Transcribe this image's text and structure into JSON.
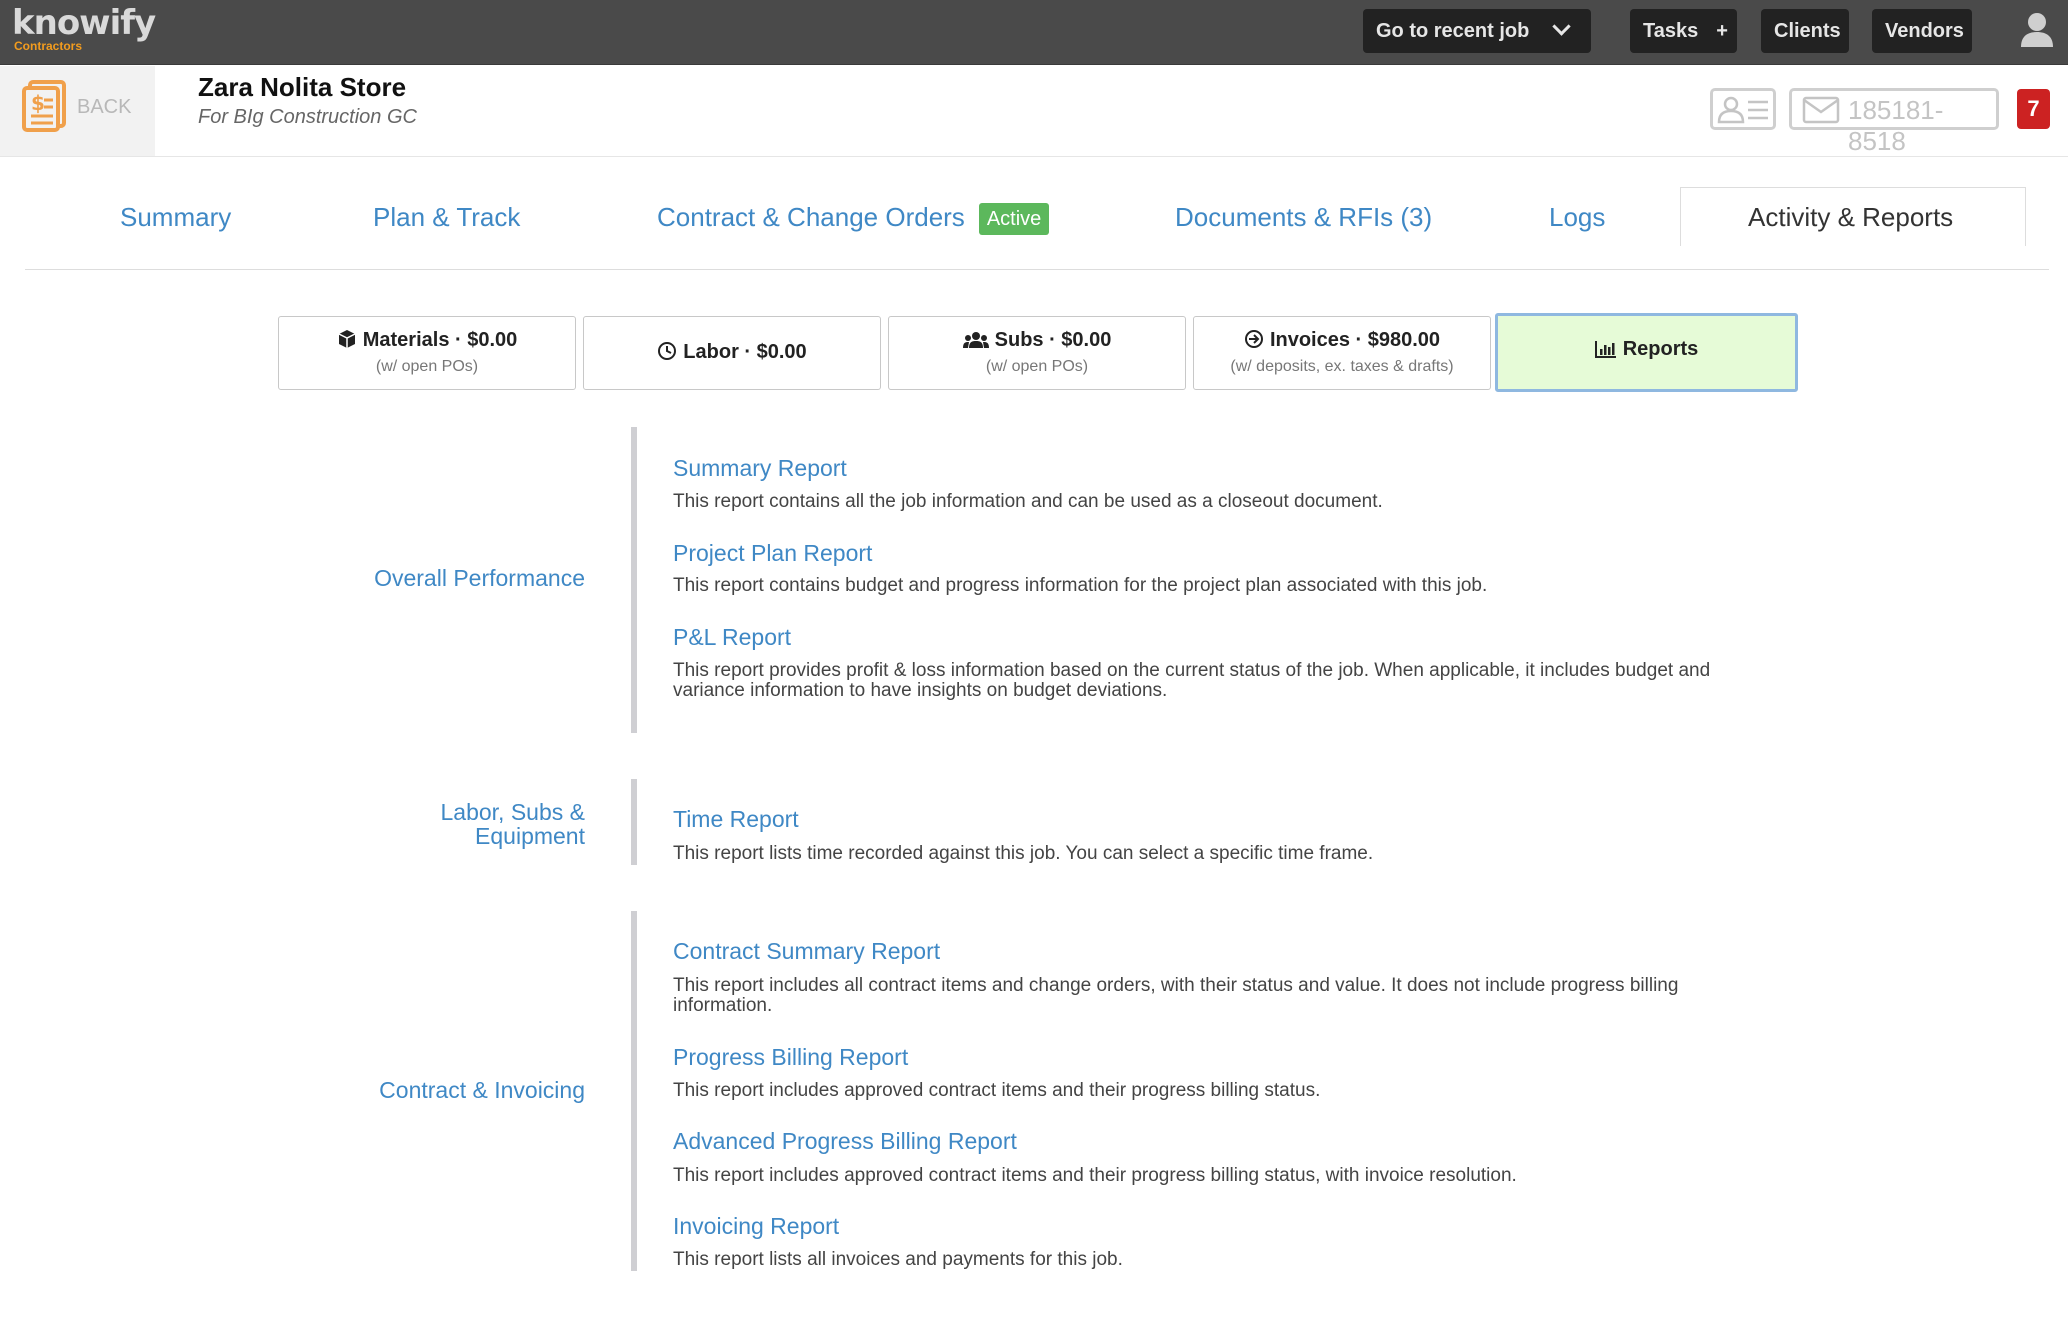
{
  "app": {
    "logo_text": "knowify",
    "logo_sub": "Contractors"
  },
  "topnav": {
    "recent_job": "Go to recent job",
    "tasks": "Tasks",
    "tasks_plus": "+",
    "clients": "Clients",
    "vendors": "Vendors"
  },
  "job": {
    "back_label": "BACK",
    "title": "Zara Nolita Store",
    "subtitle": "For BIg Construction GC",
    "phone": "185181-8518",
    "notification_count": "7"
  },
  "tabs": {
    "summary": "Summary",
    "plan_track": "Plan & Track",
    "contract": "Contract & Change Orders",
    "contract_badge": "Active",
    "documents": "Documents & RFIs (3)",
    "logs": "Logs",
    "activity": "Activity & Reports"
  },
  "summary_boxes": {
    "materials": {
      "title": "Materials · $0.00",
      "sub": "(w/ open POs)"
    },
    "labor": {
      "title": "Labor · $0.00"
    },
    "subs": {
      "title": "Subs · $0.00",
      "sub": "(w/ open POs)"
    },
    "invoices": {
      "title": "Invoices · $980.00",
      "sub": "(w/ deposits, ex. taxes & drafts)"
    },
    "reports": {
      "title": "Reports"
    }
  },
  "sections": {
    "overall": {
      "label": "Overall Performance",
      "reports": [
        {
          "title": "Summary Report",
          "desc": "This report contains all the job information and can be used as a closeout document."
        },
        {
          "title": "Project Plan Report",
          "desc": "This report contains budget and progress information for the project plan associated with this job."
        },
        {
          "title": "P&L Report",
          "desc": "This report provides profit & loss information based on the current status of the job. When applicable, it includes budget and variance information to have insights on budget deviations."
        }
      ]
    },
    "labor": {
      "label_line1": "Labor, Subs &",
      "label_line2": "Equipment",
      "reports": [
        {
          "title": "Time Report",
          "desc": "This report lists time recorded against this job. You can select a specific time frame."
        }
      ]
    },
    "contract": {
      "label": "Contract & Invoicing",
      "reports": [
        {
          "title": "Contract Summary Report",
          "desc": "This report includes all contract items and change orders, with their status and value. It does not include progress billing information."
        },
        {
          "title": "Progress Billing Report",
          "desc": "This report includes approved contract items and their progress billing status."
        },
        {
          "title": "Advanced Progress Billing Report",
          "desc": "This report includes approved contract items and their progress billing status, with invoice resolution."
        },
        {
          "title": "Invoicing Report",
          "desc": "This report lists all invoices and payments for this job."
        }
      ]
    }
  }
}
